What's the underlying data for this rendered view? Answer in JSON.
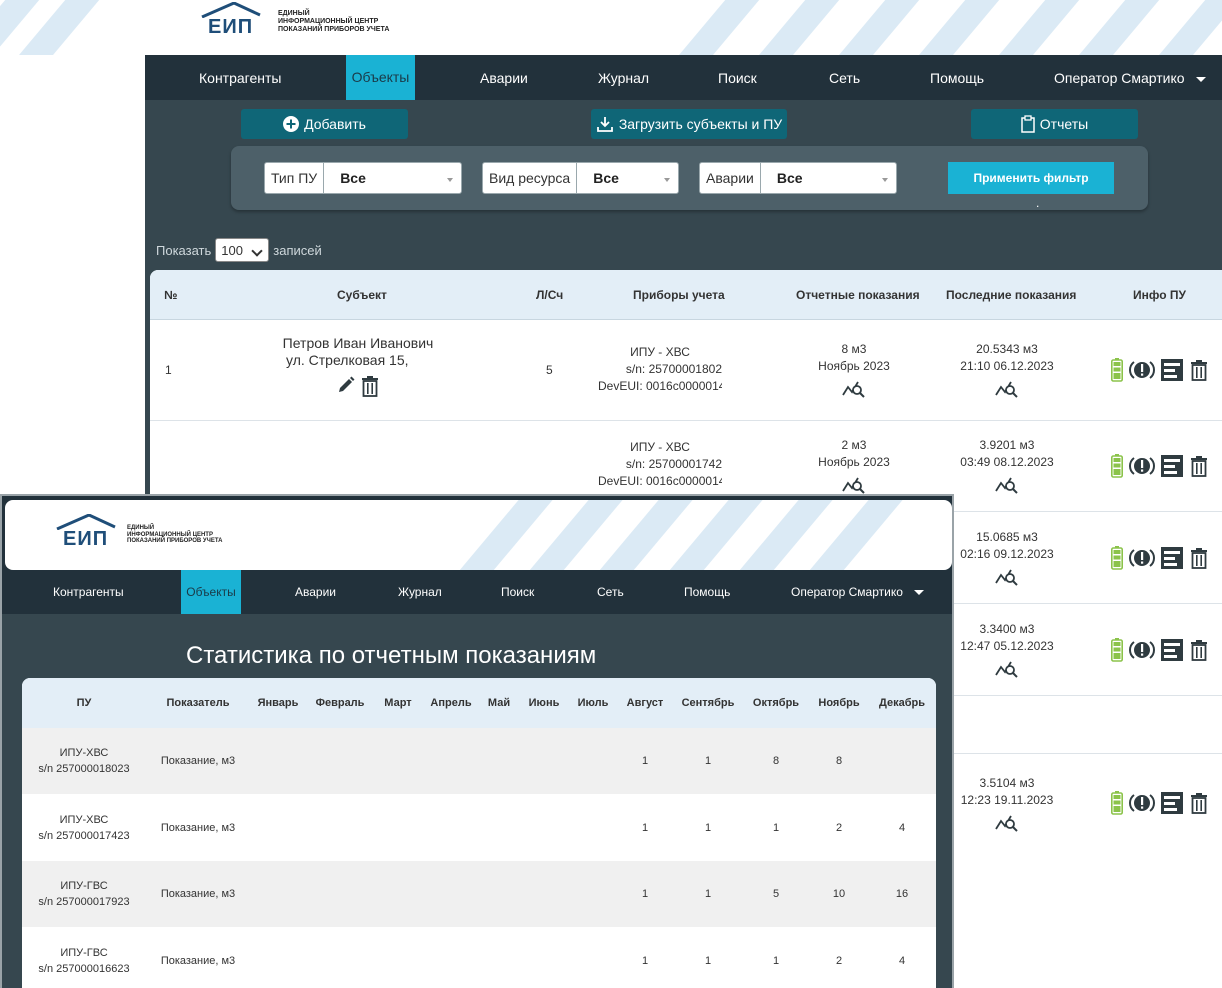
{
  "logo": {
    "mark_text": "ЕИП",
    "subtitle_line1": "ЕДИНЫЙ",
    "subtitle_line2": "ИНФОРМАЦИОННЫЙ ЦЕНТР",
    "subtitle_line3": "ПОКАЗАНИЙ ПРИБОРОВ УЧЕТА"
  },
  "nav": {
    "items": [
      "Контрагенты",
      "Объекты",
      "Аварии",
      "Журнал",
      "Поиск",
      "Сеть",
      "Помощь"
    ],
    "active": "Объекты",
    "operator": "Оператор Смартико"
  },
  "toolbar": {
    "add_label": "Добавить",
    "upload_label": "Загрузить субъекты и ПУ",
    "reports_label": "Отчеты"
  },
  "filters": {
    "pu_type_label": "Тип ПУ",
    "pu_type_value": "Все",
    "resource_label": "Вид ресурса",
    "resource_value": "Все",
    "alarms_label": "Аварии",
    "alarms_value": "Все",
    "apply_label": "Применить фильтр",
    "dot": "."
  },
  "page_size": {
    "prefix": "Показать",
    "value": "100",
    "suffix": "записей"
  },
  "objects_table": {
    "headers": {
      "num": "№",
      "subject": "Субъект",
      "account": "Л/Сч",
      "meters": "Приборы учета",
      "reported": "Отчетные показания",
      "last": "Последние показания",
      "info": "Инфо ПУ"
    },
    "rows": [
      {
        "num": "1",
        "name": "Петров Иван Иванович",
        "address": "ул. Стрелковая 15,",
        "account": "5",
        "meter_type": "ИПУ - ХВС",
        "serial": "s/n: 25700001802",
        "deveui": "DevEUI: 0016c0000014",
        "reported_value": "8 м3",
        "reported_period": "Ноябрь 2023",
        "last_value": "20.5343 м3",
        "last_time": "21:10 06.12.2023"
      },
      {
        "num": "",
        "name": "",
        "address": "",
        "account": "",
        "meter_type": "ИПУ - ХВС",
        "serial": "s/n: 25700001742",
        "deveui": "DevEUI: 0016c0000014",
        "reported_value": "2 м3",
        "reported_period": "Ноябрь 2023",
        "last_value": "3.9201 м3",
        "last_time": "03:49 08.12.2023"
      },
      {
        "last_value": "15.0685 м3",
        "last_time": "02:16 09.12.2023"
      },
      {
        "last_value": "3.3400 м3",
        "last_time": "12:47 05.12.2023"
      },
      {
        "last_value": "3.5104 м3",
        "last_time": "12:23 19.11.2023"
      }
    ]
  },
  "stats": {
    "title": "Статистика по отчетным показаниям",
    "headers": [
      "ПУ",
      "Показатель",
      "Январь",
      "Февраль",
      "Март",
      "Апрель",
      "Май",
      "Июнь",
      "Июль",
      "Август",
      "Сентябрь",
      "Октябрь",
      "Ноябрь",
      "Декабрь"
    ],
    "rows": [
      {
        "pu": "ИПУ-ХВС",
        "sn": "s/n 257000018023",
        "indicator": "Показание, м3",
        "values": [
          "",
          "",
          "",
          "",
          "",
          "",
          "",
          "1",
          "1",
          "8",
          "8",
          ""
        ]
      },
      {
        "pu": "ИПУ-ХВС",
        "sn": "s/n 257000017423",
        "indicator": "Показание, м3",
        "values": [
          "",
          "",
          "",
          "",
          "",
          "",
          "",
          "1",
          "1",
          "1",
          "2",
          "4"
        ]
      },
      {
        "pu": "ИПУ-ГВС",
        "sn": "s/n 257000017923",
        "indicator": "Показание, м3",
        "values": [
          "",
          "",
          "",
          "",
          "",
          "",
          "",
          "1",
          "1",
          "5",
          "10",
          "16"
        ]
      },
      {
        "pu": "ИПУ-ГВС",
        "sn": "s/n 257000016623",
        "indicator": "Показание, м3",
        "values": [
          "",
          "",
          "",
          "",
          "",
          "",
          "",
          "1",
          "1",
          "1",
          "2",
          "4"
        ]
      }
    ]
  },
  "colors": {
    "nav_bg": "#22313b",
    "content_bg": "#36474f",
    "accent": "#1ab2d4",
    "button": "#0f6677",
    "battery": "#8bc34a",
    "icon": "#2f3b40"
  }
}
